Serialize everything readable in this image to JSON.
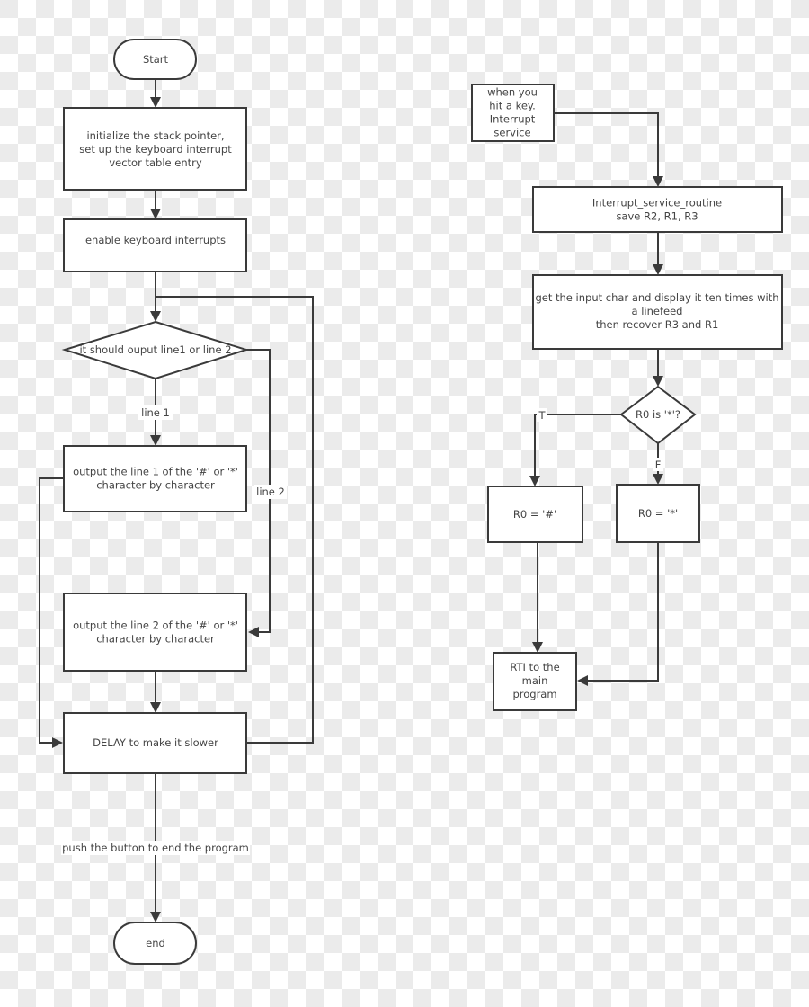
{
  "diagram": {
    "type": "flowchart",
    "main_flow": {
      "start": "Start",
      "init": [
        "initialize the stack pointer,",
        "set up the keyboard interrupt",
        "vector table entry"
      ],
      "enable": [
        "enable keyboard interrupts"
      ],
      "decision": [
        "it should ouput line1 or line 2"
      ],
      "line1_label": "line 1",
      "line2_label": "line 2",
      "output_line1": [
        "output the line 1 of the '#' or '*'",
        "character by character"
      ],
      "output_line2": [
        "output the line 2 of the '#' or '*'",
        "character by character"
      ],
      "delay": [
        "DELAY to make it slower"
      ],
      "end_label": "push the button to end the program",
      "end": "end"
    },
    "interrupt_flow": {
      "trigger": [
        "when you",
        "hit a key.",
        "Interrupt",
        "service"
      ],
      "isr": [
        "Interrupt_service_routine",
        "save R2, R1, R3"
      ],
      "process": [
        "get the input char and display it ten times with",
        "a linefeed",
        "then recover R3 and R1"
      ],
      "decision": [
        "R0 is '*'?"
      ],
      "true_label": "T",
      "false_label": "F",
      "set_hash": [
        "R0 = '#'"
      ],
      "set_star": [
        "R0 = '*'"
      ],
      "rti": [
        "RTI to the",
        "main",
        "program"
      ]
    },
    "colors": {
      "stroke": "#3a3a3a",
      "text": "#444444",
      "node_fill": "#ffffff",
      "checker_light": "#ffffff",
      "checker_dark": "#ebebeb"
    }
  }
}
